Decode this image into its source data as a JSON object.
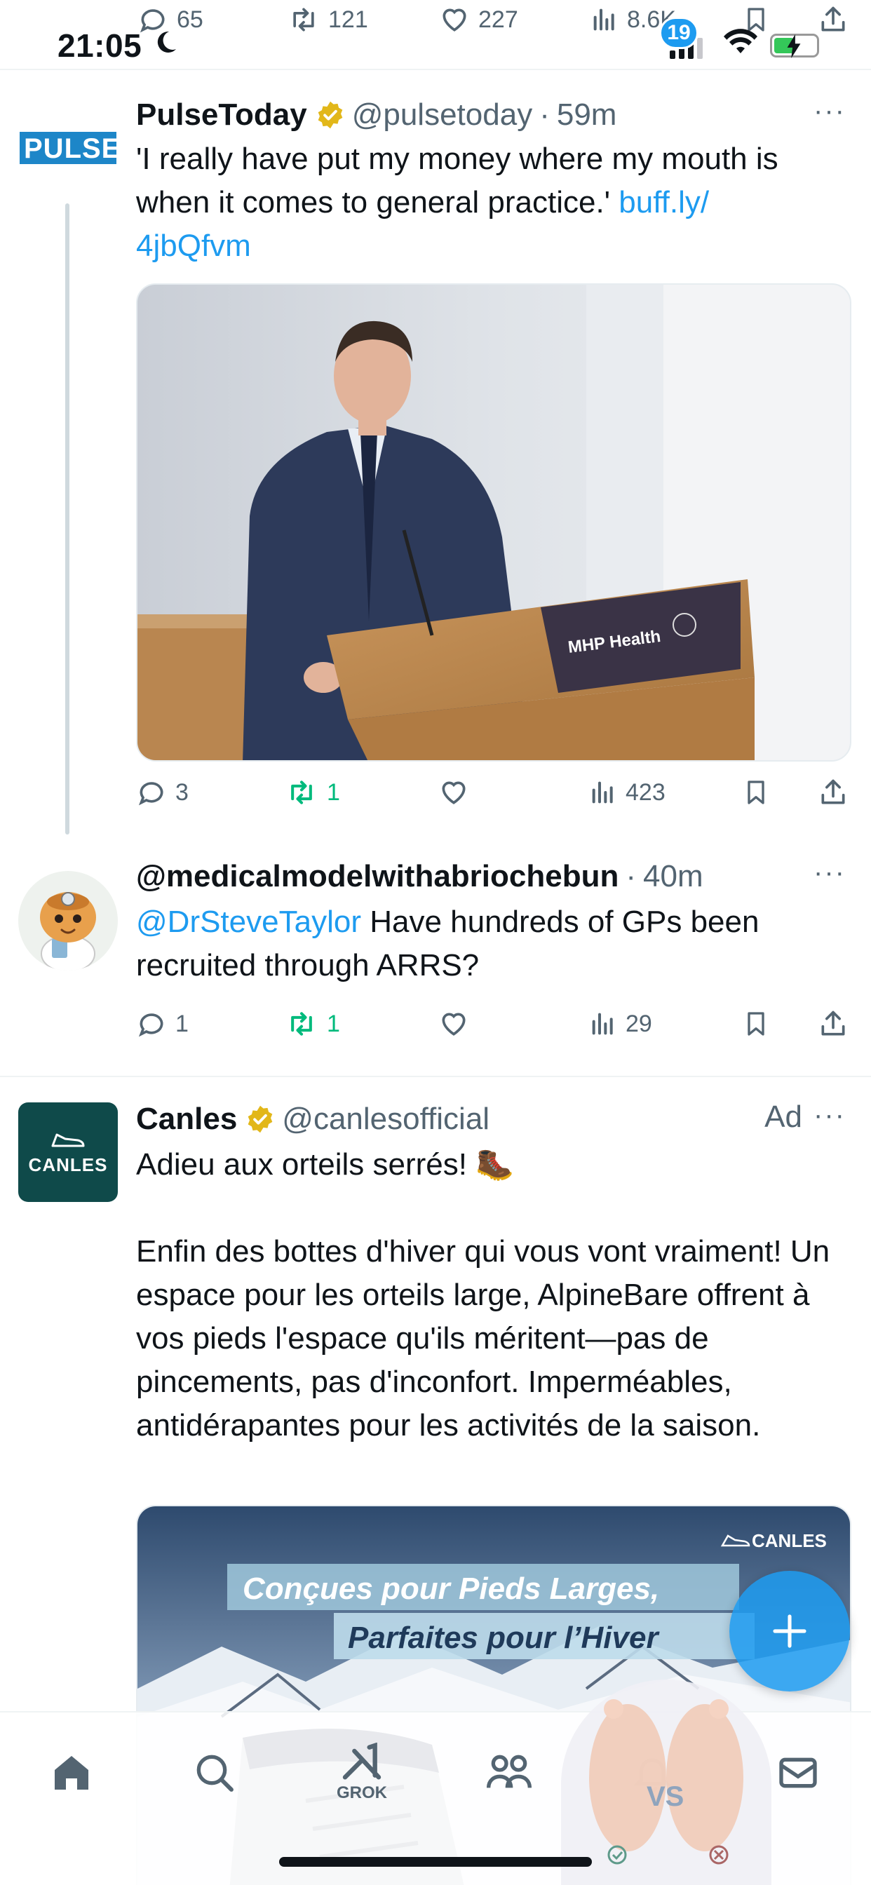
{
  "status_bar": {
    "time": "21:05"
  },
  "previous_tweet_actions": {
    "replies": "65",
    "reposts": "121",
    "likes": "227",
    "views": "8.6K"
  },
  "tweets": [
    {
      "avatar_text": "PULSE",
      "name": "PulseToday",
      "handle": "@pulsetoday",
      "time": "59m",
      "text": "'I really have put my money where my mouth is when it comes to general practice.' ",
      "link": "buff.ly/\n4jbQfvm",
      "media": {
        "podium_label": "MHP Health"
      },
      "stats": {
        "replies": "3",
        "reposts": "1",
        "likes": "",
        "views": "423"
      }
    },
    {
      "name": "@medicalmodelwithabriochebun",
      "time": "40m",
      "mention": "@DrSteveTaylor",
      "text": " Have hundreds of GPs been recruited through ARRS?",
      "stats": {
        "replies": "1",
        "reposts": "1",
        "likes": "",
        "views": "29"
      }
    },
    {
      "avatar_text": "CANLES",
      "name": "Canles",
      "handle": "@canlesofficial",
      "ad_label": "Ad",
      "text_line1": "Adieu aux orteils serrés! 🥾",
      "text_body": "Enfin des bottes d'hiver qui vous vont vraiment! Un espace pour les orteils large, AlpineBare offrent à vos pieds l'espace qu'ils méritent—pas de pincements, pas d'inconfort. Imperméables, antidérapantes pour les activités de la saison.",
      "media": {
        "brand": "CANLES",
        "headline1": "Conçues pour Pieds Larges,",
        "headline2": "Parfaites pour l’Hiver"
      }
    }
  ],
  "bottom_nav": {
    "grok_label": "GROK",
    "notifications_badge": "19",
    "overlay_text": "VS"
  },
  "colors": {
    "accent": "#1d9bf0",
    "repost": "#00ba7c",
    "secondary_text": "#536471",
    "verified": "#e2b719"
  }
}
